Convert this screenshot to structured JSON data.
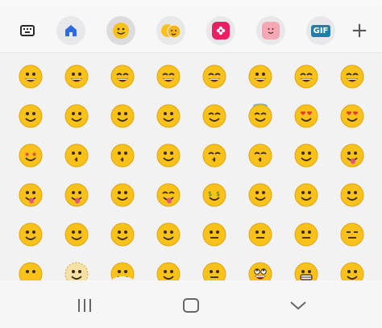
{
  "toolbar": {
    "items": [
      {
        "name": "keyboard-icon"
      },
      {
        "name": "home-icon"
      },
      {
        "name": "emoji-icon"
      },
      {
        "name": "emoji-pair-icon"
      },
      {
        "name": "sticker-flower-icon"
      },
      {
        "name": "sticker-face-icon"
      },
      {
        "name": "gif-icon",
        "label": "GIF"
      },
      {
        "name": "add-icon",
        "label": "+"
      }
    ]
  },
  "emoji_grid": {
    "rows": [
      [
        "grinning-face",
        "grinning-face-big-eyes",
        "grinning-face-smiling-eyes",
        "beaming-face",
        "grinning-squinting-face",
        "grinning-face-sweat",
        "rolling-laughing-face",
        "tears-of-joy-face"
      ],
      [
        "slightly-smiling-face",
        "upside-down-face",
        "melting-face",
        "winking-face",
        "smiling-face-smiling-eyes",
        "smiling-face-halo",
        "smiling-face-hearts",
        "heart-eyes-face"
      ],
      [
        "star-struck-face",
        "face-blowing-kiss",
        "kissing-face",
        "smiling-face",
        "kissing-face-closed-eyes",
        "kissing-face-smiling-eyes",
        "smiling-face-tear",
        "face-savoring-food"
      ],
      [
        "face-with-tongue",
        "winking-face-tongue",
        "zany-face",
        "squinting-face-tongue",
        "money-mouth-face",
        "hugging-face",
        "face-hand-over-mouth",
        "face-open-eyes-hand-over-mouth"
      ],
      [
        "face-peeking-eye",
        "shushing-face",
        "thinking-face",
        "saluting-face",
        "zipper-mouth-face",
        "face-raised-eyebrow",
        "neutral-face",
        "expressionless-face"
      ],
      [
        "face-without-mouth",
        "dotted-line-face",
        "face-in-clouds",
        "smirking-face",
        "unamused-face",
        "face-rolling-eyes",
        "grimacing-face",
        "face-exhaling"
      ]
    ]
  },
  "navbar": {
    "items": [
      {
        "name": "recent-apps-icon"
      },
      {
        "name": "home-nav-icon"
      },
      {
        "name": "back-chevron-icon"
      }
    ]
  },
  "colors": {
    "emoji_yellow": "#f8c21a",
    "emoji_outline": "#e2a40e",
    "sticker_pink": "#e91e63",
    "sticker_rose": "#f7a6b4",
    "gif_blue": "#1e7fa8",
    "home_blue": "#2d6cdf"
  }
}
